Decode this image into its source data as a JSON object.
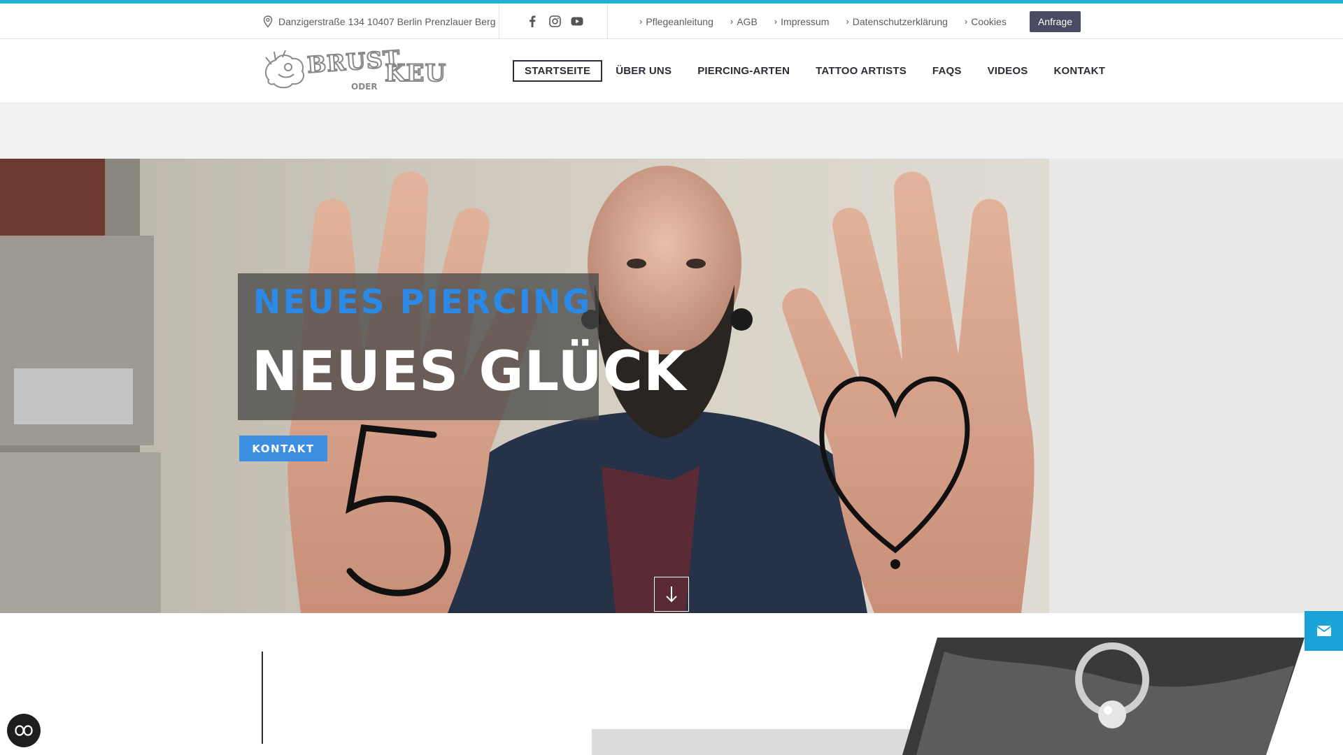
{
  "topbar": {
    "address": "Danzigerstraße 134 10407 Berlin Prenzlauer Berg",
    "socials": [
      "facebook-icon",
      "instagram-icon",
      "youtube-icon"
    ],
    "links": [
      "Pflegeanleitung",
      "AGB",
      "Impressum",
      "Datenschutzerklärung",
      "Cookies"
    ],
    "request_button": "Anfrage"
  },
  "header": {
    "logo_text": "BRUST ODER KEULE",
    "nav": [
      "STARTSEITE",
      "ÜBER UNS",
      "PIERCING-ARTEN",
      "TATTOO ARTISTS",
      "FAQS",
      "VIDEOS",
      "KONTAKT"
    ],
    "active_nav": "STARTSEITE"
  },
  "hero": {
    "subtitle": "NEUES PIERCING",
    "title": "NEUES GLÜCK",
    "button": "KONTAKT"
  },
  "colors": {
    "accent": "#1fb0d3",
    "hero_subtitle": "#2b8ae6",
    "button": "#3c8ee0",
    "request_button": "#4a4a63",
    "mail_tab": "#1ba3d8"
  },
  "icons": {
    "address": "map-pin-icon",
    "scroll": "arrow-down-icon",
    "mail": "envelope-icon",
    "accessibility": "accessibility-icon"
  }
}
